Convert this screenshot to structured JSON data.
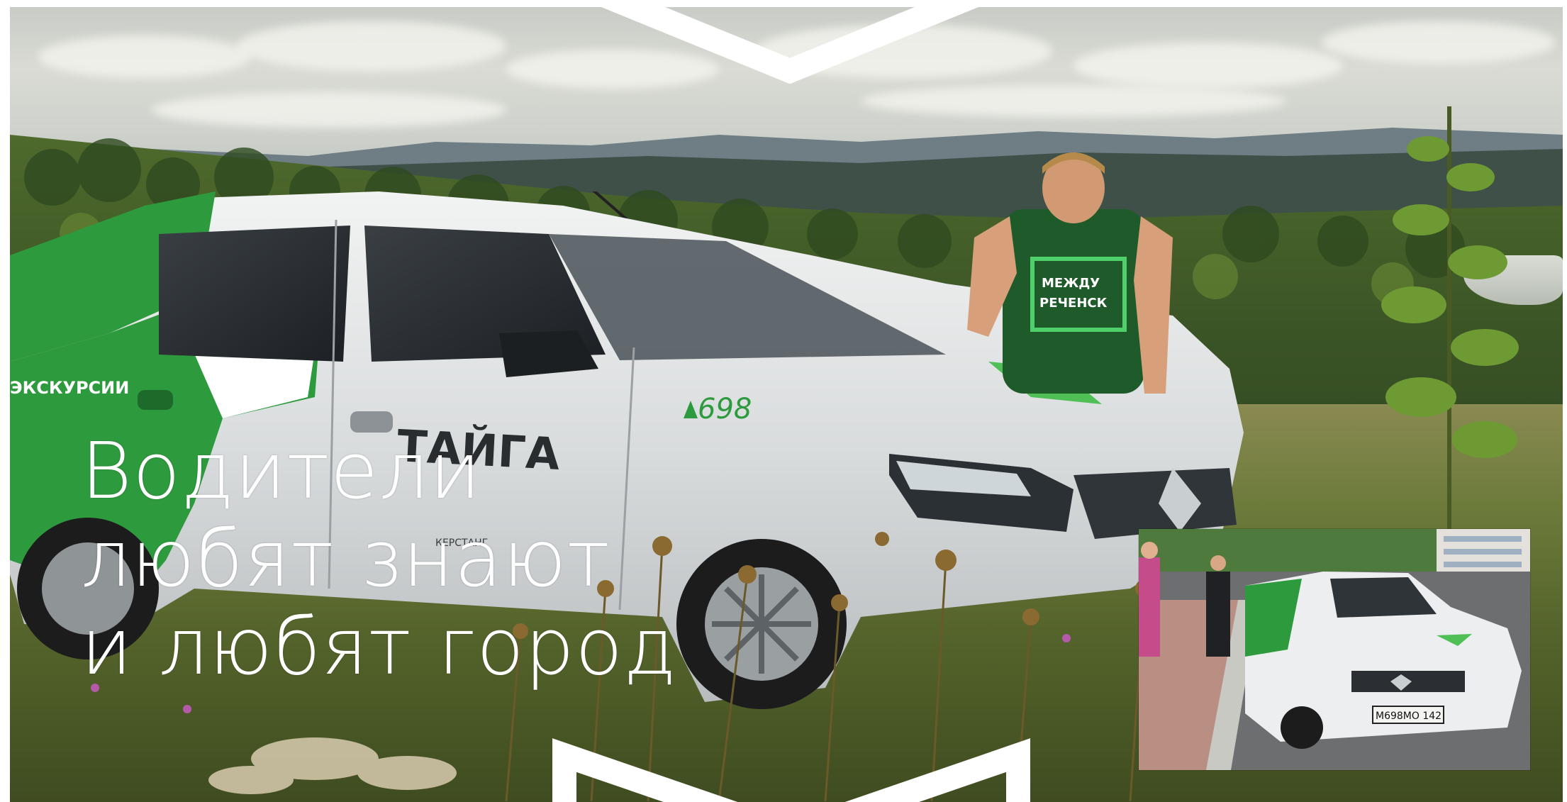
{
  "headline": {
    "line1": "Водители",
    "line2": "любят знают",
    "line3": "и любят город"
  },
  "car": {
    "brand_text": "ТАЙГА",
    "side_text": "ЭКСКУРСИИ",
    "number": "698",
    "small_text": "КЕРСТАНГ"
  },
  "shirt": {
    "line1": "МЕЖДУ",
    "line2": "РЕЧЕНСК"
  },
  "inset": {
    "plate": "М698МО 142"
  },
  "colors": {
    "brand_green": "#2e9a3e",
    "headline": "#ffffff",
    "chevron": "#ffffff",
    "car_body": "#dcdfe0"
  }
}
